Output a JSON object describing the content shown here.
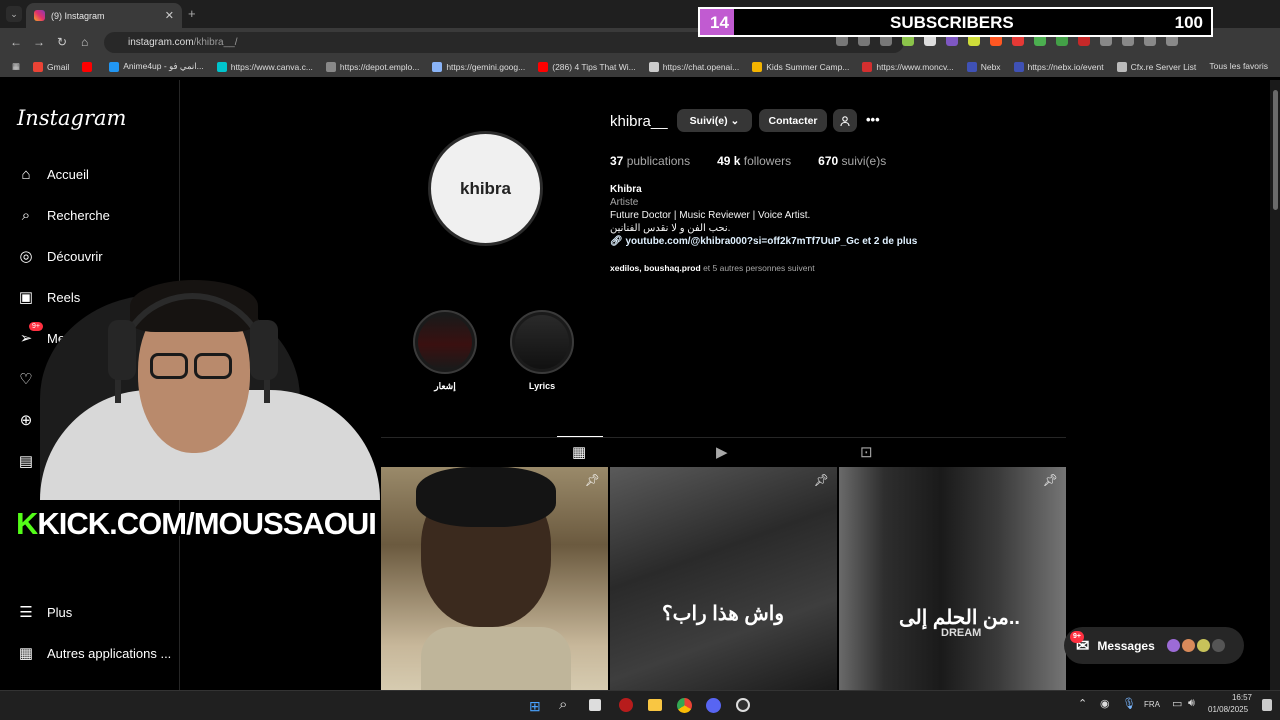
{
  "browser": {
    "tab_title": "(9) Instagram",
    "tab_close": "✕",
    "new_tab": "+",
    "url_host": "instagram.com",
    "url_path": "/khibra__/",
    "bookmarks": [
      {
        "label": "Gmail",
        "color": "#ea4335"
      },
      {
        "label": "",
        "color": "#ff0000"
      },
      {
        "label": "Anime4up - انمي فو...",
        "color": "#2196f3"
      },
      {
        "label": "https://www.canva.c...",
        "color": "#00c4cc"
      },
      {
        "label": "https://depot.emplo...",
        "color": "#888888"
      },
      {
        "label": "https://gemini.goog...",
        "color": "#8ab4f8"
      },
      {
        "label": "(286) 4 Tips That Wi...",
        "color": "#ff0000"
      },
      {
        "label": "https://chat.openai...",
        "color": "#cccccc"
      },
      {
        "label": "Kids Summer Camp...",
        "color": "#f4b400"
      },
      {
        "label": "https://www.moncv...",
        "color": "#d32f2f"
      },
      {
        "label": "Nebx",
        "color": "#3f51b5"
      },
      {
        "label": "https://nebx.io/event",
        "color": "#3f51b5"
      },
      {
        "label": "Cfx.re Server List",
        "color": "#bbbbbb"
      }
    ],
    "favoris": "Tous les favoris"
  },
  "overlay": {
    "subs_count": "14",
    "subs_label": "SUBSCRIBERS",
    "subs_goal": "100",
    "subs_progress": 0.14,
    "kick_k": "K",
    "kick_text": "KICK.COM/MOUSSAOUI"
  },
  "sidebar": {
    "logo": "Instagram",
    "items": [
      {
        "label": "Accueil",
        "icon": "⌂"
      },
      {
        "label": "Recherche",
        "icon": "⌕"
      },
      {
        "label": "Découvrir",
        "icon": "◎"
      },
      {
        "label": "Reels",
        "icon": "▣"
      },
      {
        "label": "Messages",
        "icon": "➢",
        "badge": "9+"
      },
      {
        "label": "Notif",
        "icon": "♡"
      },
      {
        "label": "",
        "icon": "⊕"
      },
      {
        "label": "Tab",
        "icon": "▤"
      }
    ],
    "more": "Plus",
    "more_icon": "☰",
    "apps": "Autres applications ...",
    "apps_icon": "▦"
  },
  "profile": {
    "username": "khibra__",
    "avatar_text": "khibra",
    "follow_btn": "Suivi(e) ⌄",
    "contact_btn": "Contacter",
    "more_icon": "•••",
    "posts_count": "37",
    "posts_label": "publications",
    "followers_count": "49 k",
    "followers_label": "followers",
    "following_count": "670",
    "following_label": "suivi(e)s",
    "name": "Khibra",
    "category": "Artiste",
    "bio1": "Future Doctor | Music Reviewer | Voice Artist.",
    "bio2": "نحب الفن و لا نقدس الفنانين.",
    "link": "youtube.com/@khibra000?si=off2k7mTf7UuP_Gc et 2 de plus",
    "followed_names": "xedilos, boushaq.prod",
    "followed_rest": "et 5 autres personnes suivent"
  },
  "highlights": [
    {
      "label": "إشعار"
    },
    {
      "label": "Lyrics"
    }
  ],
  "posts": [
    {
      "caption": ""
    },
    {
      "caption": "واش هذا راب؟"
    },
    {
      "caption": "من الحلم إلى..",
      "sub": "DREAM"
    }
  ],
  "messages_pill": {
    "label": "Messages",
    "badge": "9+"
  },
  "taskbar": {
    "lang": "FRA",
    "time": "16:57",
    "date": "01/08/2025"
  }
}
